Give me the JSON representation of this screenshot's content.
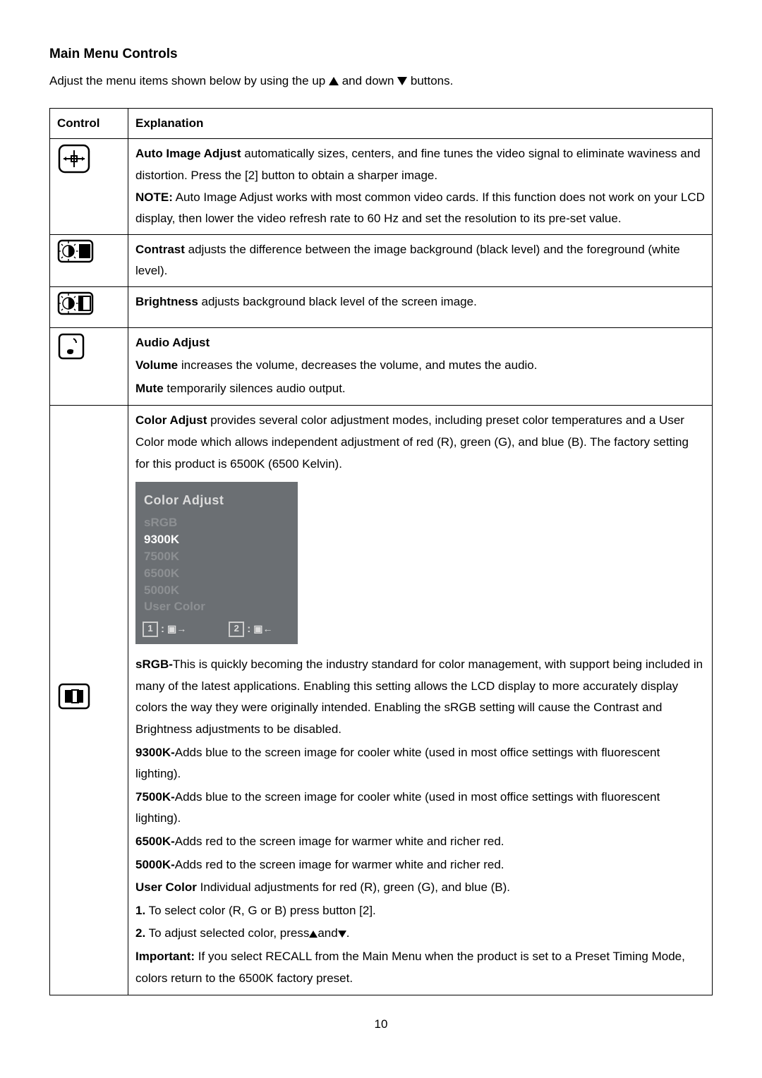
{
  "heading": "Main Menu Controls",
  "intro_prefix": "Adjust the menu items shown below by using the up ",
  "intro_middle": " and down ",
  "intro_suffix": " buttons.",
  "headers": {
    "col1": "Control",
    "col2": "Explanation"
  },
  "rows": {
    "auto_image": {
      "title": "Auto Image Adjust",
      "body1": " automatically sizes, centers, and fine tunes the video signal to eliminate waviness and distortion. Press the [2] button to obtain a sharper image.",
      "note_label": "NOTE:",
      "note_body": " Auto Image Adjust works with most common video cards. If this function does not work on your LCD display, then lower the video refresh rate to 60 Hz and set the resolution to its pre-set value."
    },
    "contrast": {
      "title": "Contrast",
      "body": " adjusts the difference between the image background (black level) and the foreground (white level)."
    },
    "brightness": {
      "title": "Brightness",
      "body": " adjusts background black level of the screen image."
    },
    "audio": {
      "title": "Audio Adjust",
      "vol_label": "Volume",
      "vol_body": " increases the volume, decreases the volume, and mutes the audio.",
      "mute_label": "Mute",
      "mute_body": " temporarily silences audio output."
    },
    "color": {
      "title": "Color Adjust",
      "body1": " provides several color adjustment modes, including preset color temperatures and a User Color mode which allows independent adjustment of red (R), green (G), and blue (B). The factory setting for this product is 6500K (6500 Kelvin).",
      "osd": {
        "title": "Color Adjust",
        "items": [
          "sRGB",
          "9300K",
          "7500K",
          "6500K",
          "5000K",
          "User Color"
        ],
        "key1": "1",
        "key2": "2"
      },
      "srgb_label": "sRGB-",
      "srgb_body": "This is quickly becoming the industry standard for color management, with support being included in many of the latest applications. Enabling this setting allows the LCD display to more accurately display colors the way they were originally intended. Enabling the sRGB setting will cause the Contrast and Brightness adjustments to be disabled.",
      "k9300_label": "9300K-",
      "k9300_body": "Adds blue to the screen image for cooler white (used in most office settings with fluorescent lighting).",
      "k7500_label": "7500K-",
      "k7500_body": "Adds blue to the screen image for cooler white (used in most office settings with fluorescent lighting).",
      "k6500_label": "6500K-",
      "k6500_body": "Adds red to the screen image for warmer white and richer red.",
      "k5000_label": "5000K-",
      "k5000_body": "Adds red to the screen image for warmer white and richer red.",
      "user_label": "User Color",
      "user_body": " Individual adjustments for red (R), green (G), and blue (B).",
      "step1_label": "1.",
      "step1_body": " To select color (R, G or B) press button [2].",
      "step2_label": "2.",
      "step2_body_a": " To adjust selected color, press",
      "step2_body_b": "and",
      "step2_body_c": ".",
      "important_label": "Important:",
      "important_body": " If you select RECALL from the Main Menu when the product is set to a Preset Timing Mode, colors return to the 6500K factory preset."
    }
  },
  "page_number": "10"
}
